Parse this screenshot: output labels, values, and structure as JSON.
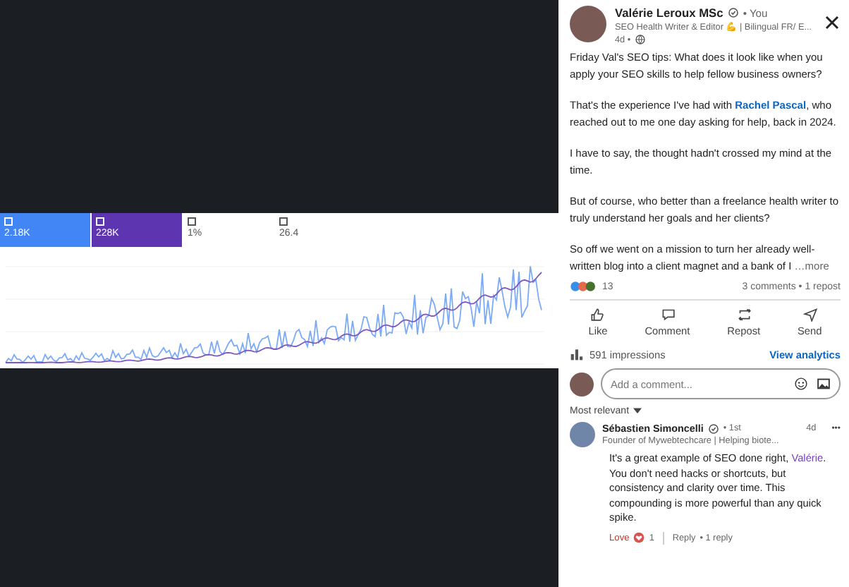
{
  "metrics": [
    {
      "value": "2.18K",
      "checked": true,
      "color": "#4285f4"
    },
    {
      "value": "228K",
      "checked": true,
      "color": "#5e35b1"
    },
    {
      "value": "1%",
      "checked": false
    },
    {
      "value": "26.4",
      "checked": false
    }
  ],
  "post": {
    "author": "Valérie Leroux MSc",
    "relation": "• You",
    "headline": "SEO Health Writer & Editor 💪 | Bilingual FR/ E...",
    "age": "4d •",
    "paragraphs": [
      "Friday Val's SEO tips: What does it look like when you apply your SEO skills to help fellow business owners?",
      "That's the experience I've had with **Rachel Pascal**, who reached out to me one day asking for help, back in 2024.",
      "I have to say, the thought hadn't crossed my mind at the time.",
      "But of course, who better than a freelance health writer to truly understand her goals and her clients?",
      "So off we went on a mission to turn her already well-written blog into a client magnet and a bank of I"
    ],
    "more": "…more",
    "reaction_count": "13",
    "stats": "3 comments • 1 repost",
    "actions": [
      {
        "kind": "like",
        "label": "Like"
      },
      {
        "kind": "comment",
        "label": "Comment"
      },
      {
        "kind": "repost",
        "label": "Repost"
      },
      {
        "kind": "send",
        "label": "Send"
      }
    ],
    "impressions": "591 impressions",
    "analytics": "View analytics"
  },
  "comment_box": {
    "placeholder": "Add a comment..."
  },
  "sort": "Most relevant",
  "comment": {
    "author": "Sébastien Simoncelli",
    "relation": "• 1st",
    "age": "4d",
    "menu": "•••",
    "headline": "Founder of Mywebtechcare | Helping biote...",
    "text": "It's a great example of SEO done right, **Valérie**. You don't need hacks or shortcuts, but consistency and clarity over time. This compounding is more powerful than any quick spike.",
    "reaction": "Love",
    "reaction_count": "1",
    "reply": "Reply",
    "replies": "• 1 reply"
  }
}
